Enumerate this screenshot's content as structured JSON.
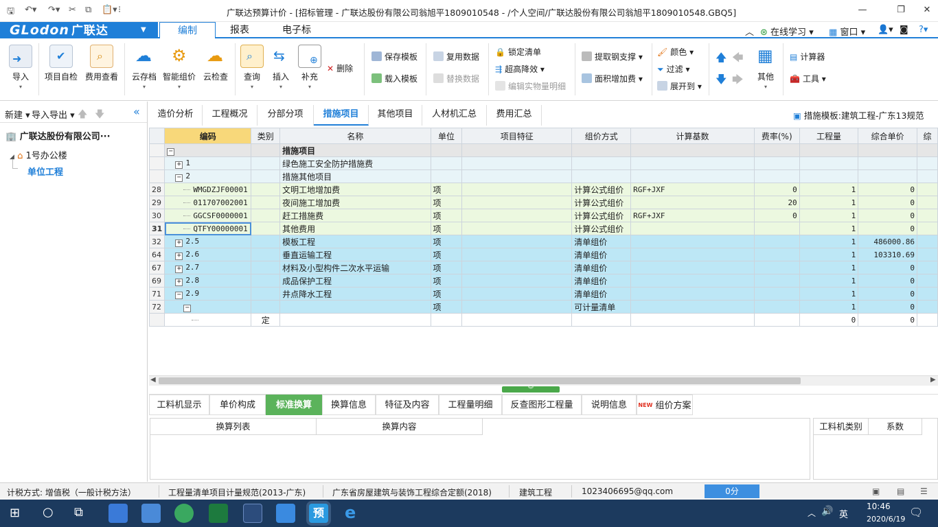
{
  "window": {
    "title": "广联达预算计价 - [招标管理 - 广联达股份有限公司翁旭平1809010548 - /个人空间/广联达股份有限公司翁旭平1809010548.GBQ5]"
  },
  "logo": {
    "brand": "GLodon",
    "cn": "广联达"
  },
  "ribbon_tabs": [
    "编制",
    "报表",
    "电子标"
  ],
  "ribbon_right": {
    "learn": "在线学习",
    "window": "窗口"
  },
  "ribbon": {
    "import": "导入",
    "self_check": "项目自检",
    "fee_view": "费用查看",
    "cloud_save": "云存档",
    "smart_price": "智能组价",
    "cloud_check": "云检查",
    "query": "查询",
    "insert": "插入",
    "supplement": "补充",
    "delete": "删除",
    "save_template": "保存模板",
    "load_template": "载入模板",
    "reuse_data": "复用数据",
    "replace_data": "替换数据",
    "lock_list": "锁定清单",
    "height_reduce": "超高降效",
    "edit_detail": "编辑实物量明细",
    "steel_support": "提取钢支撑",
    "area_fee": "面积增加费",
    "color": "颜色",
    "filter": "过滤",
    "expand": "展开到",
    "other": "其他",
    "calculator": "计算器",
    "tools": "工具"
  },
  "left_panel": {
    "new": "新建",
    "import_export": "导入导出",
    "company": "广联达股份有限公司···",
    "building": "1号办公楼",
    "unit": "单位工程"
  },
  "content_tabs": [
    "造价分析",
    "工程概况",
    "分部分项",
    "措施项目",
    "其他项目",
    "人材机汇总",
    "费用汇总"
  ],
  "template_label": "措施模板:建筑工程-广东13规范",
  "grid": {
    "headers": [
      "编码",
      "类别",
      "名称",
      "单位",
      "项目特征",
      "组价方式",
      "计算基数",
      "费率(%)",
      "工程量",
      "综合单价",
      "综"
    ],
    "rows": [
      {
        "rn": "",
        "code": "",
        "cat": "",
        "name": "措施项目",
        "unit": "",
        "feat": "",
        "method": "",
        "base": "",
        "rate": "",
        "qty": "",
        "price": "",
        "style": "hdr",
        "pm": "−",
        "indent": 0
      },
      {
        "rn": "",
        "code": "1",
        "cat": "",
        "name": "绿色施工安全防护措施费",
        "unit": "",
        "feat": "",
        "method": "",
        "base": "",
        "rate": "",
        "qty": "",
        "price": "",
        "style": "sub",
        "pm": "+",
        "indent": 1
      },
      {
        "rn": "",
        "code": "2",
        "cat": "",
        "name": "措施其他项目",
        "unit": "",
        "feat": "",
        "method": "",
        "base": "",
        "rate": "",
        "qty": "",
        "price": "",
        "style": "sub",
        "pm": "−",
        "indent": 1
      },
      {
        "rn": "28",
        "code": "WMGDZJF00001",
        "cat": "",
        "name": "文明工地增加费",
        "unit": "项",
        "feat": "",
        "method": "计算公式组价",
        "base": "RGF+JXF",
        "rate": "0",
        "qty": "1",
        "price": "0",
        "style": "green",
        "pm": "",
        "indent": 2
      },
      {
        "rn": "29",
        "code": "011707002001",
        "cat": "",
        "name": "夜间施工增加费",
        "unit": "项",
        "feat": "",
        "method": "计算公式组价",
        "base": "",
        "rate": "20",
        "qty": "1",
        "price": "0",
        "style": "green",
        "pm": "",
        "indent": 2
      },
      {
        "rn": "30",
        "code": "GGCSF0000001",
        "cat": "",
        "name": "赶工措施费",
        "unit": "项",
        "feat": "",
        "method": "计算公式组价",
        "base": "RGF+JXF",
        "rate": "0",
        "qty": "1",
        "price": "0",
        "style": "green",
        "pm": "",
        "indent": 2
      },
      {
        "rn": "31",
        "code": "QTFY00000001",
        "cat": "",
        "name": "其他费用",
        "unit": "项",
        "feat": "",
        "method": "计算公式组价",
        "base": "",
        "rate": "",
        "qty": "1",
        "price": "0",
        "style": "green",
        "pm": "",
        "indent": 2,
        "current": true
      },
      {
        "rn": "32",
        "code": "2.5",
        "cat": "",
        "name": "模板工程",
        "unit": "项",
        "feat": "",
        "method": "清单组价",
        "base": "",
        "rate": "",
        "qty": "1",
        "price": "486000.86",
        "style": "blue",
        "pm": "+",
        "indent": 1
      },
      {
        "rn": "64",
        "code": "2.6",
        "cat": "",
        "name": "垂直运输工程",
        "unit": "项",
        "feat": "",
        "method": "清单组价",
        "base": "",
        "rate": "",
        "qty": "1",
        "price": "103310.69",
        "style": "blue",
        "pm": "+",
        "indent": 1
      },
      {
        "rn": "67",
        "code": "2.7",
        "cat": "",
        "name": "材料及小型构件二次水平运输",
        "unit": "项",
        "feat": "",
        "method": "清单组价",
        "base": "",
        "rate": "",
        "qty": "1",
        "price": "0",
        "style": "blue",
        "pm": "+",
        "indent": 1
      },
      {
        "rn": "69",
        "code": "2.8",
        "cat": "",
        "name": "成品保护工程",
        "unit": "项",
        "feat": "",
        "method": "清单组价",
        "base": "",
        "rate": "",
        "qty": "1",
        "price": "0",
        "style": "blue",
        "pm": "+",
        "indent": 1
      },
      {
        "rn": "71",
        "code": "2.9",
        "cat": "",
        "name": "井点降水工程",
        "unit": "项",
        "feat": "",
        "method": "清单组价",
        "base": "",
        "rate": "",
        "qty": "1",
        "price": "0",
        "style": "blue",
        "pm": "−",
        "indent": 1
      },
      {
        "rn": "72",
        "code": "",
        "cat": "",
        "name": "",
        "unit": "项",
        "feat": "",
        "method": "可计量清单",
        "base": "",
        "rate": "",
        "qty": "1",
        "price": "0",
        "style": "blue",
        "pm": "−",
        "indent": 2
      },
      {
        "rn": "",
        "code": "",
        "cat": "定",
        "name": "",
        "unit": "",
        "feat": "",
        "method": "",
        "base": "",
        "rate": "",
        "qty": "0",
        "price": "0",
        "style": "white",
        "pm": "",
        "indent": 3
      }
    ]
  },
  "bottom_tabs": [
    "工料机显示",
    "单价构成",
    "标准换算",
    "换算信息",
    "特征及内容",
    "工程量明细",
    "反查图形工程量",
    "说明信息",
    "组价方案"
  ],
  "bottom_left_headers": [
    "换算列表",
    "换算内容"
  ],
  "bottom_right_headers": [
    "工料机类别",
    "系数"
  ],
  "status": {
    "tax": "计税方式: 增值税（一般计税方法）",
    "spec": "工程量清单项目计量规范(2013-广东)",
    "quota": "广东省房屋建筑与装饰工程综合定额(2018)",
    "type": "建筑工程",
    "email": "1023406695@qq.com",
    "score": "0分"
  },
  "taskbar": {
    "time": "10:46",
    "date": "2020/6/19",
    "lang": "英"
  },
  "colors": {
    "accent": "#1f7fd8",
    "green_row": "#ecf8e0",
    "blue_row": "#bde7f6",
    "active_tab_green": "#5bb35b",
    "taskbar": "#1c3a5e"
  }
}
